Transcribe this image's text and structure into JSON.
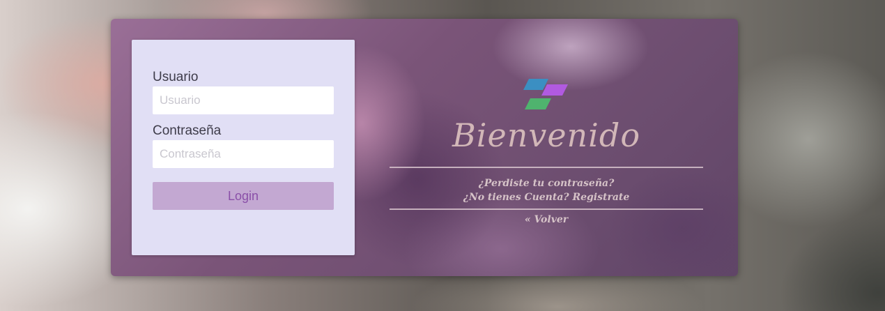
{
  "login": {
    "username_label": "Usuario",
    "username_placeholder": "Usuario",
    "username_value": "",
    "password_label": "Contraseña",
    "password_placeholder": "Contraseña",
    "password_value": "",
    "submit_label": "Login"
  },
  "welcome": {
    "logo_icon": "stacked-parallelograms-logo-icon",
    "title": "Bienvenido",
    "forgot_password_link": "¿Perdiste tu contraseña?",
    "register_link": "¿No tienes Cuenta? Registrate",
    "back_link": "« Volver"
  },
  "colors": {
    "panel_bg": "#e1dff5",
    "button_bg": "#c3a8d2",
    "button_text": "#8a4fa8",
    "logo_blue": "#3b8fc2",
    "logo_purple": "#b15ae0",
    "logo_green": "#4fb36e",
    "title_color": "#d2b7b8"
  }
}
